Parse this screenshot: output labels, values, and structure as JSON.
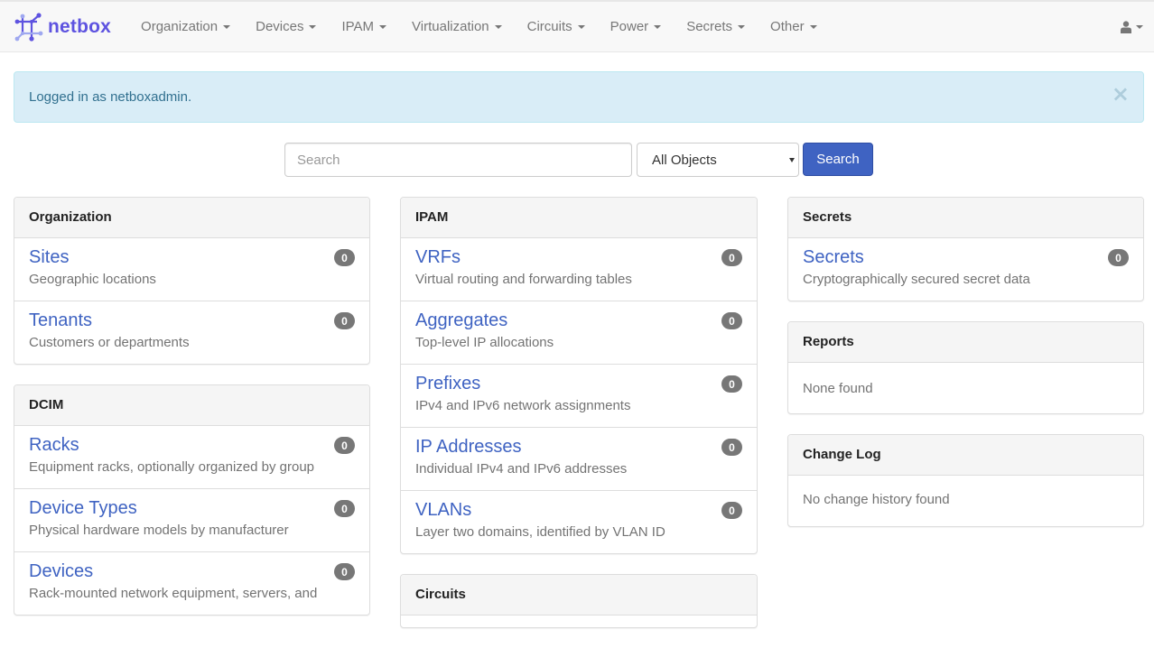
{
  "navbar": {
    "brand": "netbox",
    "items": [
      {
        "label": "Organization"
      },
      {
        "label": "Devices"
      },
      {
        "label": "IPAM"
      },
      {
        "label": "Virtualization"
      },
      {
        "label": "Circuits"
      },
      {
        "label": "Power"
      },
      {
        "label": "Secrets"
      },
      {
        "label": "Other"
      }
    ],
    "user_icon": "user-icon"
  },
  "alert": {
    "message": "Logged in as netboxadmin.",
    "close": "×"
  },
  "search": {
    "placeholder": "Search",
    "value": "",
    "scope": "All Objects",
    "button_label": "Search"
  },
  "panels": {
    "organization": {
      "title": "Organization",
      "items": [
        {
          "label": "Sites",
          "description": "Geographic locations",
          "count": "0"
        },
        {
          "label": "Tenants",
          "description": "Customers or departments",
          "count": "0"
        }
      ]
    },
    "dcim": {
      "title": "DCIM",
      "items": [
        {
          "label": "Racks",
          "description": "Equipment racks, optionally organized by group",
          "count": "0"
        },
        {
          "label": "Device Types",
          "description": "Physical hardware models by manufacturer",
          "count": "0"
        },
        {
          "label": "Devices",
          "description": "Rack-mounted network equipment, servers, and",
          "count": "0"
        }
      ]
    },
    "ipam": {
      "title": "IPAM",
      "items": [
        {
          "label": "VRFs",
          "description": "Virtual routing and forwarding tables",
          "count": "0"
        },
        {
          "label": "Aggregates",
          "description": "Top-level IP allocations",
          "count": "0"
        },
        {
          "label": "Prefixes",
          "description": "IPv4 and IPv6 network assignments",
          "count": "0"
        },
        {
          "label": "IP Addresses",
          "description": "Individual IPv4 and IPv6 addresses",
          "count": "0"
        },
        {
          "label": "VLANs",
          "description": "Layer two domains, identified by VLAN ID",
          "count": "0"
        }
      ]
    },
    "circuits": {
      "title": "Circuits"
    },
    "secrets": {
      "title": "Secrets",
      "items": [
        {
          "label": "Secrets",
          "description": "Cryptographically secured secret data",
          "count": "0"
        }
      ]
    },
    "reports": {
      "title": "Reports",
      "body": "None found"
    },
    "changelog": {
      "title": "Change Log",
      "body": "No change history found"
    }
  },
  "colors": {
    "brand": "#5e53e0",
    "link": "#3f63c2",
    "primary_button": "#3f63c2",
    "alert_bg": "#d9edf7",
    "alert_text": "#31708f",
    "badge": "#777777"
  }
}
